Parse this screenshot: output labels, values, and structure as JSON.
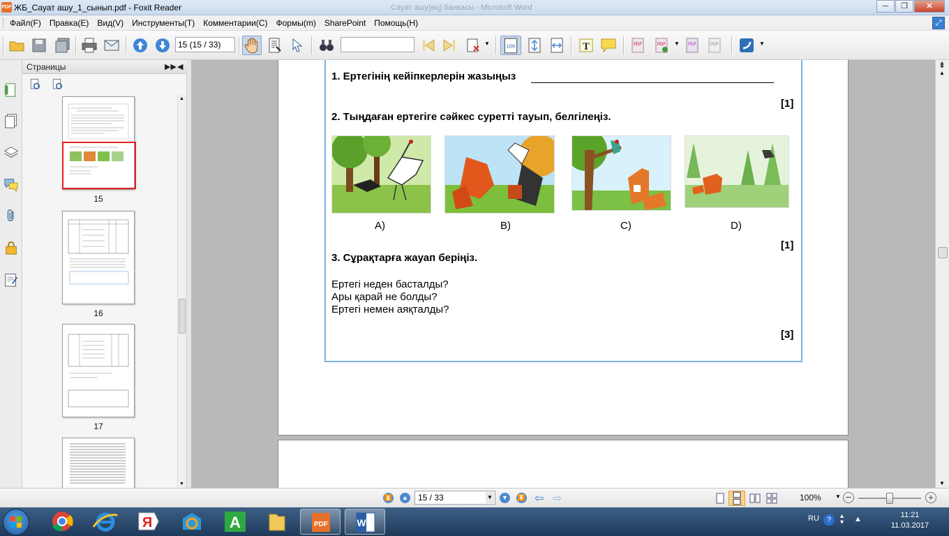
{
  "window": {
    "title": "ЖБ_Сауат ашу_1_сынып.pdf - Foxit Reader",
    "background_window_title": "Сауат ашу(ең) банкасы - Microsoft Word",
    "app_icon_text": "PDF"
  },
  "menu": [
    "Файл(F)",
    "Правка(E)",
    "Вид(V)",
    "Инструменты(T)",
    "Комментарии(C)",
    "Формы(m)",
    "SharePoint",
    "Помощь(H)"
  ],
  "toolbar": {
    "page_field": "15 (15 / 33)",
    "search_placeholder": ""
  },
  "panel": {
    "title": "Страницы",
    "thumbnails": [
      {
        "label": "15",
        "selected": true
      },
      {
        "label": "16",
        "selected": false
      },
      {
        "label": "17",
        "selected": false
      },
      {
        "label": "",
        "selected": false
      }
    ]
  },
  "document": {
    "q1": "1. Ертегінің кейіпкерлерін жазыңыз",
    "q1_mark": "[1]",
    "q2": "2. Тыңдаған ертегіге сәйкес суретті тауып, белгілеңіз.",
    "options": [
      "A)",
      "B)",
      "C)",
      "D)"
    ],
    "q2_mark": "[1]",
    "q3": "3. Сұрақтарға жауап беріңіз.",
    "lines": [
      "Ертегі неден басталды?",
      "Ары қарай не болды?",
      "Ертегі немен аяқталды?"
    ],
    "q3_mark": "[3]"
  },
  "status": {
    "page_indicator": "15 / 33",
    "zoom": "100%",
    "zoom_level": 0.5
  },
  "taskbar": {
    "lang": "RU",
    "time": "11:21",
    "date": "11.03.2017"
  },
  "colors": {
    "accent": "#4b8ad3",
    "frame_border": "#7fb2de",
    "selected_thumb": "#e02020"
  }
}
